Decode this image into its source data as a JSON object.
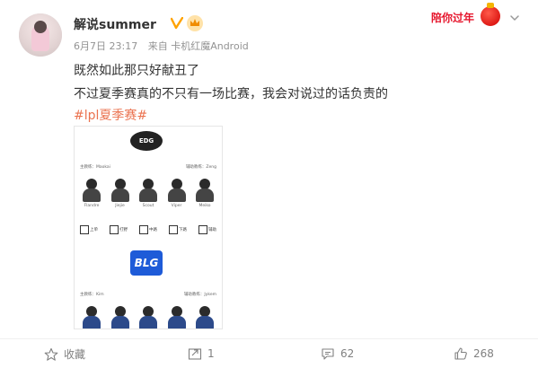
{
  "user": {
    "name": "解说summer",
    "meta_date": "6月7日 23:17",
    "meta_source": "来自 卡机红魔Android"
  },
  "promo": {
    "text": "陪你过年"
  },
  "post": {
    "line1": "既然如此那只好献丑了",
    "line2": "不过夏季赛真的不只有一场比赛，我会对说过的话负责的",
    "tag": "#lpl夏季赛#"
  },
  "image": {
    "team1": {
      "logo": "EDG",
      "coach_label": "主教练：Maokai",
      "assistant_label": "辅助教练：Zeng",
      "players": [
        "Flandre",
        "Jiejie",
        "Scout",
        "Viper",
        "Meiko"
      ]
    },
    "roles": [
      "上单",
      "打野",
      "中路",
      "下路",
      "辅助"
    ],
    "team2": {
      "logo": "BLG",
      "coach_label": "主教练：Kim",
      "assistant_label": "辅助教练：Jykem"
    }
  },
  "actions": {
    "collect": "收藏",
    "repost": "1",
    "comment": "62",
    "like": "268"
  },
  "colors": {
    "accent": "#eb7350",
    "promo": "#e6162d",
    "verified": "#ffa200"
  }
}
